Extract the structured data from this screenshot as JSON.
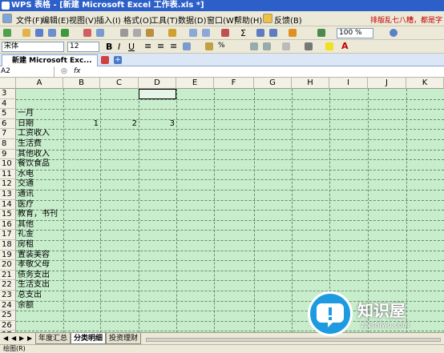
{
  "window": {
    "title": "WPS 表格 - [新建 Microsoft Excel 工作表.xls *]"
  },
  "menu": {
    "items": [
      "文件(F)",
      "编辑(E)",
      "视图(V)",
      "插入(I)",
      "格式(O)",
      "工具(T)",
      "数据(D)",
      "窗口(W)",
      "帮助(H)"
    ],
    "feedback": "反馈(B)",
    "notice": "排版乱七八糟，都是字"
  },
  "toolbar": {
    "zoom": "100 %"
  },
  "format": {
    "font": "宋体",
    "size": "12"
  },
  "tabs": {
    "doc": "新建 Microsoft Exc..."
  },
  "formula": {
    "namebox": "A2",
    "fx": "fx"
  },
  "columns": [
    "A",
    "B",
    "C",
    "D",
    "E",
    "F",
    "G",
    "H",
    "I",
    "J",
    "K"
  ],
  "rows": [
    "3",
    "4",
    "5",
    "6",
    "7",
    "8",
    "9",
    "10",
    "11",
    "12",
    "13",
    "14",
    "15",
    "16",
    "17",
    "18",
    "19",
    "20",
    "21",
    "22",
    "23",
    "24",
    "25",
    "26",
    "27"
  ],
  "cells": {
    "a5": "一月",
    "a6": "日期",
    "b6": "1",
    "c6": "2",
    "d6": "3",
    "a7": "工资收入",
    "a8": "生活费",
    "a9": "其他收入",
    "a10": "餐饮食品",
    "a11": "水电",
    "a12": "交通",
    "a13": "通讯",
    "a14": "医疗",
    "a15": "教育，书刊",
    "a16": "其他",
    "a17": "礼金",
    "a18": "房租",
    "a19": "置装美容",
    "a20": "孝敬父母",
    "a21": "债务支出",
    "a22": "生活支出",
    "a23": "总支出",
    "a24": "余额"
  },
  "sheets": [
    "年度汇总",
    "分类明细",
    "投资理财"
  ],
  "status": {
    "text": "绘图(R)"
  },
  "watermark": {
    "name": "知识屋",
    "url": "zhishiwu.com"
  }
}
